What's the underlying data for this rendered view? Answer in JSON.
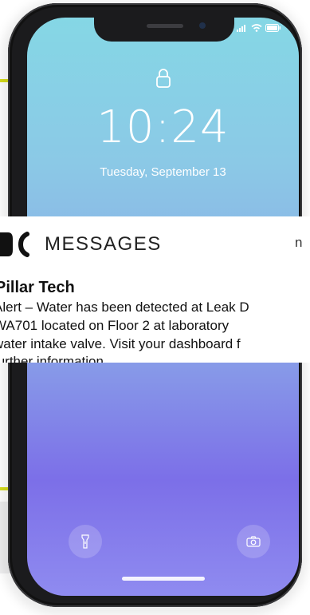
{
  "lockscreen": {
    "time": "10:24",
    "date": "Tuesday, September 13"
  },
  "status_bar": {
    "signal_icon": "signal-icon",
    "wifi_icon": "wifi-icon",
    "battery_icon": "battery-icon"
  },
  "notification": {
    "app_name": "MESSAGES",
    "time_partial": "n",
    "sender": "Pillar Tech",
    "body_lines": [
      "Alert – Water has been detected at Leak D",
      "WA701 located on Floor 2 at laboratory",
      "water intake valve. Visit your dashboard f",
      "further information."
    ]
  },
  "bottom_controls": {
    "flashlight_icon": "flashlight-icon",
    "camera_icon": "camera-icon"
  },
  "colors": {
    "accent_stripe": "#d7dd1c",
    "screen_top": "#85d7e5",
    "screen_bottom": "#8f8bf0"
  }
}
